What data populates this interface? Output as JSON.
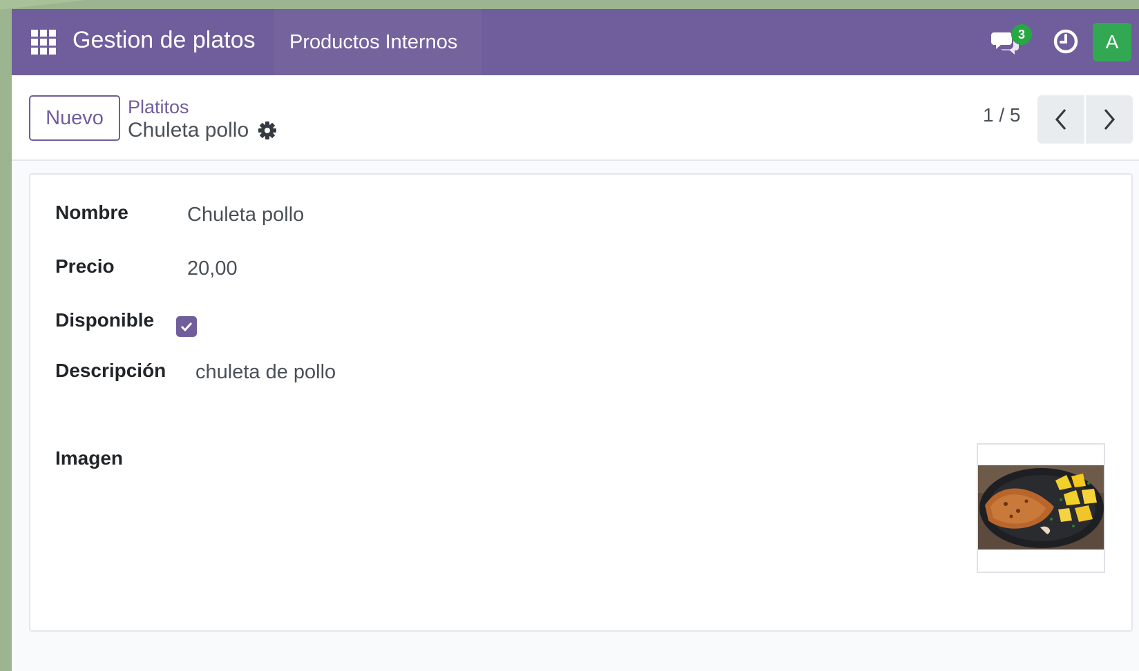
{
  "navbar": {
    "app_name": "Gestion de platos",
    "menu_item": "Productos Internos",
    "chat_badge_count": "3",
    "avatar_initial": "A",
    "brand_color": "#705d9b"
  },
  "control_panel": {
    "new_button": "Nuevo",
    "breadcrumb_parent": "Platitos",
    "breadcrumb_current": "Chuleta pollo",
    "pager_value": "1 / 5"
  },
  "form": {
    "nombre_label": "Nombre",
    "nombre_value": "Chuleta pollo",
    "precio_label": "Precio",
    "precio_value": "20,00",
    "disponible_label": "Disponible",
    "disponible_checked": true,
    "descripcion_label": "Descripción",
    "descripcion_value": "chuleta de pollo",
    "imagen_label": "Imagen"
  },
  "icons": [
    "apps-grid-icon",
    "chat-icon",
    "clock-icon",
    "gear-icon",
    "chevron-left-icon",
    "chevron-right-icon",
    "check-icon"
  ]
}
